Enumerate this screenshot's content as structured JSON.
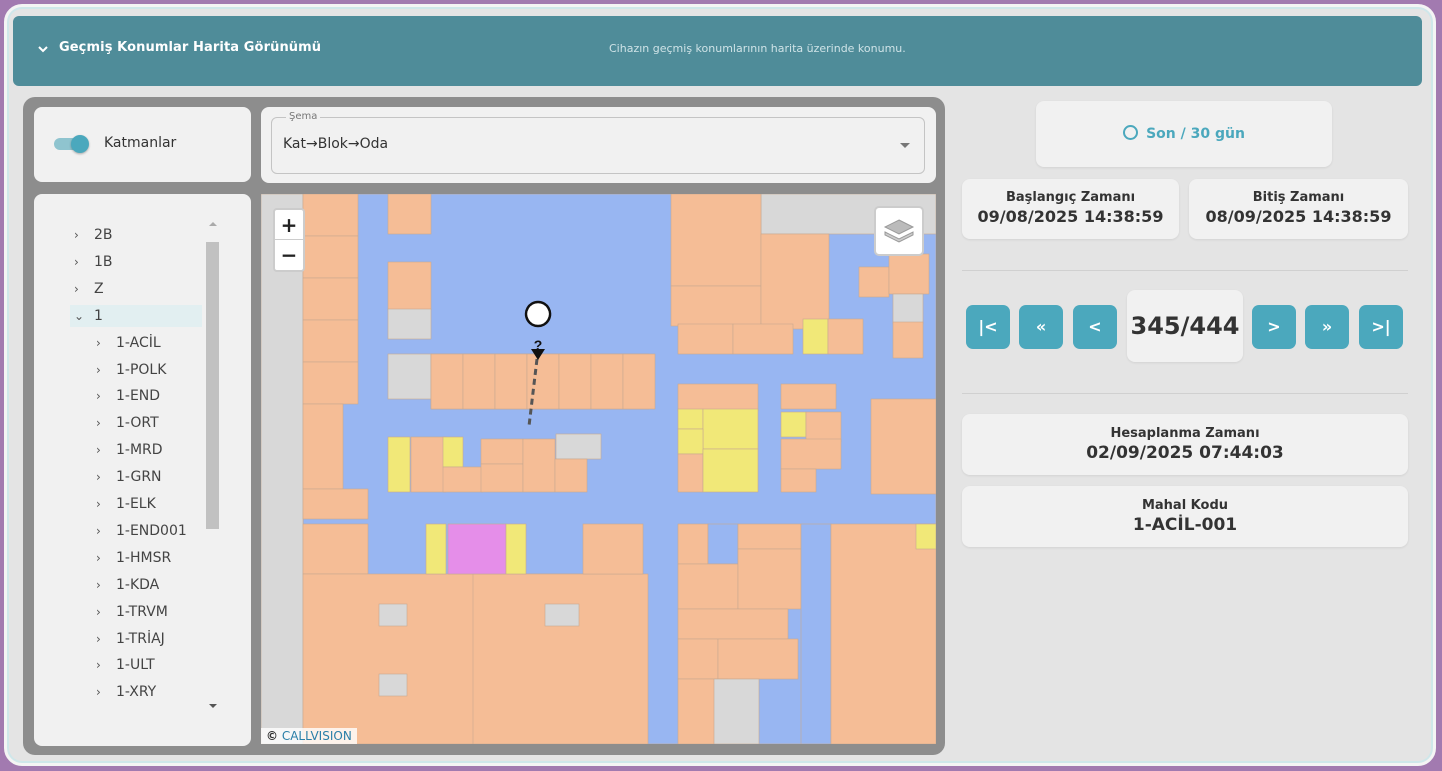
{
  "header": {
    "title": "Geçmiş Konumlar Harita Görünümü",
    "description": "Cihazın geçmiş konumlarının harita üzerinde konumu."
  },
  "layers": {
    "label": "Katmanlar",
    "enabled": true
  },
  "schema": {
    "legend": "Şema",
    "value": "Kat→Blok→Oda"
  },
  "tree": {
    "items": [
      {
        "label": "2B",
        "level": 0,
        "expanded": false
      },
      {
        "label": "1B",
        "level": 0,
        "expanded": false
      },
      {
        "label": "Z",
        "level": 0,
        "expanded": false
      },
      {
        "label": "1",
        "level": 0,
        "expanded": true,
        "selected": true
      },
      {
        "label": "1-ACİL",
        "level": 1,
        "expanded": false
      },
      {
        "label": "1-POLK",
        "level": 1,
        "expanded": false
      },
      {
        "label": "1-END",
        "level": 1,
        "expanded": false
      },
      {
        "label": "1-ORT",
        "level": 1,
        "expanded": false
      },
      {
        "label": "1-MRD",
        "level": 1,
        "expanded": false
      },
      {
        "label": "1-GRN",
        "level": 1,
        "expanded": false
      },
      {
        "label": "1-ELK",
        "level": 1,
        "expanded": false
      },
      {
        "label": "1-END001",
        "level": 1,
        "expanded": false
      },
      {
        "label": "1-HMSR",
        "level": 1,
        "expanded": false
      },
      {
        "label": "1-KDA",
        "level": 1,
        "expanded": false
      },
      {
        "label": "1-TRVM",
        "level": 1,
        "expanded": false
      },
      {
        "label": "1-TRİAJ",
        "level": 1,
        "expanded": false
      },
      {
        "label": "1-ULT",
        "level": 1,
        "expanded": false
      },
      {
        "label": "1-XRY",
        "level": 1,
        "expanded": false
      }
    ]
  },
  "map": {
    "zoom_in": "+",
    "zoom_out": "−",
    "attribution_prefix": "©",
    "attribution_name": "CALLVISION",
    "colors": {
      "room": "#f5bd96",
      "corridor": "#98b6f2",
      "yellow": "#f1e878",
      "pink": "#e58ee9",
      "gray": "#d8d8d8"
    }
  },
  "time_range": {
    "label": "Son / 30 gün",
    "icon": "clock-icon"
  },
  "start": {
    "label": "Başlangıç Zamanı",
    "value": "09/08/2025 14:38:59"
  },
  "end": {
    "label": "Bitiş Zamanı",
    "value": "08/09/2025 14:38:59"
  },
  "navigation": {
    "first": "|<",
    "prev_fast": "«",
    "prev": "<",
    "next": ">",
    "next_fast": "»",
    "last": ">|",
    "counter": "345/444"
  },
  "calc_time": {
    "label": "Hesaplanma Zamanı",
    "value": "02/09/2025 07:44:03"
  },
  "place_code": {
    "label": "Mahal Kodu",
    "value": "1-ACİL-001"
  },
  "accent_color": "#4ba8bd",
  "header_color": "#4f8c99"
}
